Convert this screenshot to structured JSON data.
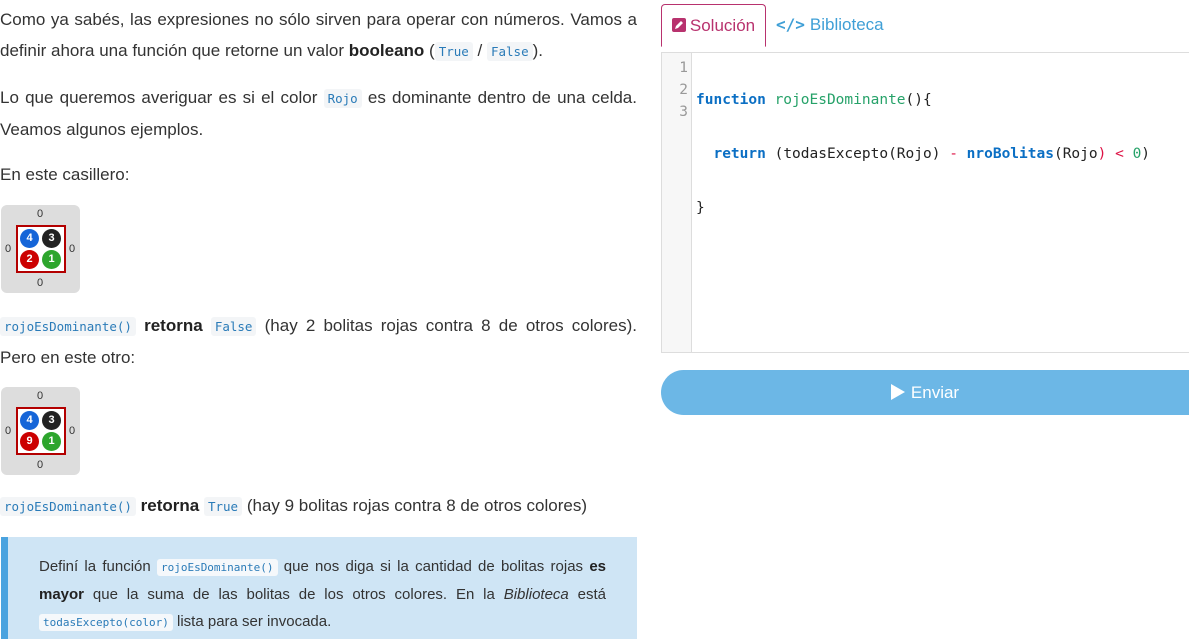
{
  "para1": {
    "text1": "Como ya sabés, las expresiones no sólo sirven para operar con números. Vamos a definir ahora una función que retorne un valor ",
    "bold": "booleano",
    "text2": " (",
    "code_true": "True",
    "sep": " / ",
    "code_false": "False",
    "text3": ")."
  },
  "para2": {
    "text1": "Lo que queremos averiguar es si el color ",
    "code": "Rojo",
    "text2": " es dominante dentro de una celda. Veamos algunos ejemplos."
  },
  "para3": {
    "text": "En este casillero:"
  },
  "board1": {
    "top": "0",
    "bottom": "0",
    "left": "0",
    "right": "0",
    "balls": {
      "blue": "4",
      "black": "3",
      "red": "2",
      "green": "1"
    }
  },
  "para4": {
    "code_fn": "rojoEsDominante()",
    "bold": "retorna",
    "code_val": "False",
    "text": " (hay 2 bolitas rojas contra 8 de otros colores). Pero en este otro:"
  },
  "board2": {
    "top": "0",
    "bottom": "0",
    "left": "0",
    "right": "0",
    "balls": {
      "blue": "4",
      "black": "3",
      "red": "9",
      "green": "1"
    }
  },
  "para5": {
    "code_fn": "rojoEsDominante()",
    "bold": "retorna",
    "code_val": "True",
    "text": " (hay 9 bolitas rojas contra 8 de otros colores)"
  },
  "note": {
    "text1": "Definí la función ",
    "code_fn": "rojoEsDominante()",
    "text2": " que nos diga si la cantidad de bolitas rojas ",
    "bold1": "es mayor",
    "text3": " que la suma de las bolitas de los otros colores. En la ",
    "italic": "Biblioteca",
    "text4": " está ",
    "code_lib": "todasExcepto(color)",
    "text5": " lista para ser invocada."
  },
  "tabs": {
    "solution": "Solución",
    "library": "Biblioteca"
  },
  "editor": {
    "line_numbers": [
      "1",
      "2",
      "3"
    ],
    "line1": {
      "kw": "function",
      "fn": "rojoEsDominante",
      "rest": "(){"
    },
    "line2": {
      "indent": "  ",
      "kw": "return",
      "a": " (todasExcepto(Rojo) ",
      "op": "-",
      "fn": "nroBolitas",
      "b": "(Rojo",
      "op2": ")",
      "c": " ",
      "lt": "<",
      "d": " ",
      "num": "0",
      "e": ")"
    },
    "line3": {
      "text": "}"
    }
  },
  "send_label": "Enviar",
  "colors": {
    "accent_pink": "#b8326e",
    "accent_blue": "#3f9fd6",
    "button": "#6cb7e6",
    "note_bg": "#cfe5f5"
  }
}
